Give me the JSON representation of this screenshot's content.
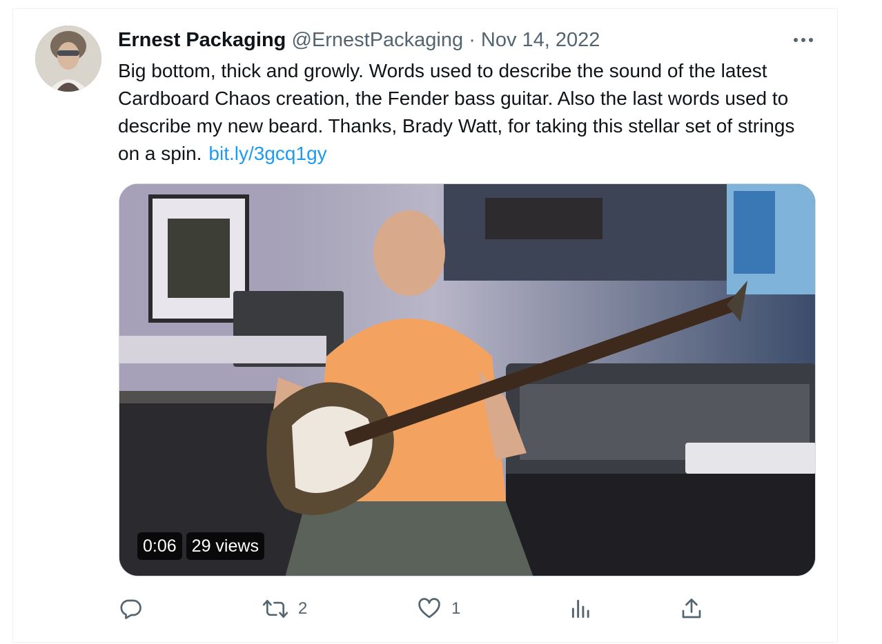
{
  "tweet": {
    "author": {
      "display_name": "Ernest Packaging",
      "handle": "@ErnestPackaging"
    },
    "separator": "·",
    "date": "Nov 14, 2022",
    "text": "Big bottom, thick and growly. Words used to describe the sound of the latest Cardboard Chaos creation, the Fender bass guitar. Also the last words used to describe my new beard. Thanks, Brady Watt, for taking this stellar set of strings on a spin.",
    "link": "bit.ly/3gcq1gy",
    "media": {
      "duration": "0:06",
      "views": "29 views"
    },
    "actions": {
      "reply_icon": "reply-icon",
      "retweet_icon": "retweet-icon",
      "retweet_count": "2",
      "like_icon": "heart-icon",
      "like_count": "1",
      "analytics_icon": "analytics-icon",
      "share_icon": "share-icon"
    },
    "more_icon": "more-icon"
  },
  "colors": {
    "text": "#0f1419",
    "secondary": "#536471",
    "link": "#1d9bf0",
    "border": "#eff3f4"
  }
}
